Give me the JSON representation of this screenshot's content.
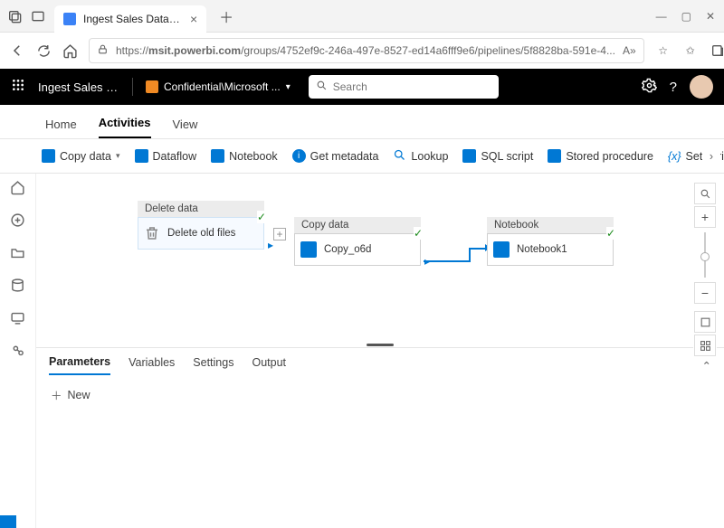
{
  "browser": {
    "tab_title": "Ingest Sales Data - Data enginee",
    "url_host": "msit.powerbi.com",
    "url_rest": "/groups/4752ef9c-246a-497e-8527-ed14a6fff9e6/pipelines/5f8828ba-591e-4...",
    "reader_label": "A»"
  },
  "appbar": {
    "title": "Ingest Sales D...",
    "sensitivity": "Confidential\\Microsoft ...",
    "search_placeholder": "Search"
  },
  "pagetabs": {
    "home": "Home",
    "activities": "Activities",
    "view": "View"
  },
  "toolbar": {
    "copy_data": "Copy data",
    "dataflow": "Dataflow",
    "notebook": "Notebook",
    "get_metadata": "Get metadata",
    "lookup": "Lookup",
    "sql_script": "SQL script",
    "stored_procedure": "Stored procedure",
    "set_variable": "Set variable",
    "if_cond": "If"
  },
  "nodes": {
    "delete": {
      "header": "Delete data",
      "label": "Delete old files"
    },
    "copy": {
      "header": "Copy data",
      "label": "Copy_o6d"
    },
    "notebook": {
      "header": "Notebook",
      "label": "Notebook1"
    }
  },
  "panel": {
    "parameters": "Parameters",
    "variables": "Variables",
    "settings": "Settings",
    "output": "Output",
    "new": "New"
  }
}
